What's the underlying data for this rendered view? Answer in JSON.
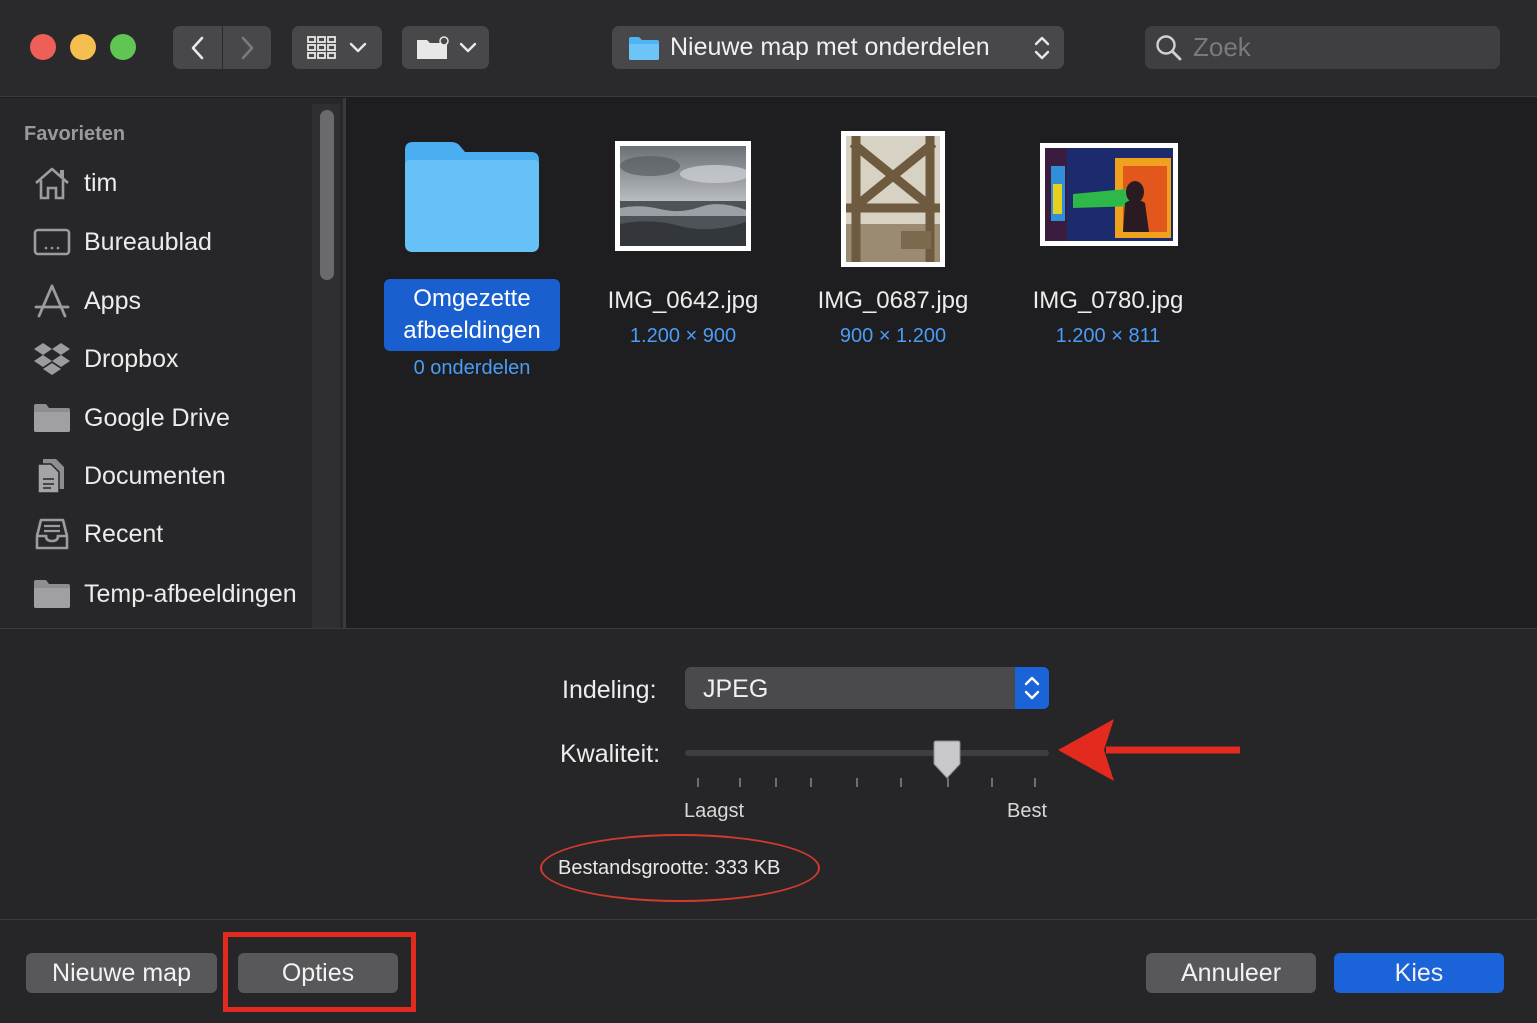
{
  "toolbar": {
    "path_label": "Nieuwe map met onderdelen",
    "search_placeholder": "Zoek",
    "icons": [
      "chevron-left-icon",
      "chevron-right-icon",
      "grid-view-icon",
      "chevron-down-icon",
      "folder-action-icon",
      "folder-icon",
      "updown-arrows-icon",
      "search-icon"
    ]
  },
  "sidebar": {
    "heading": "Favorieten",
    "items": [
      {
        "label": "tim",
        "icon": "home-icon"
      },
      {
        "label": "Bureaublad",
        "icon": "desktop-icon"
      },
      {
        "label": "Apps",
        "icon": "apps-icon"
      },
      {
        "label": "Dropbox",
        "icon": "dropbox-icon"
      },
      {
        "label": "Google Drive",
        "icon": "folder-icon"
      },
      {
        "label": "Documenten",
        "icon": "document-icon"
      },
      {
        "label": "Recent",
        "icon": "recent-icon"
      },
      {
        "label": "Temp-afbeeldingen",
        "icon": "folder-icon"
      }
    ]
  },
  "files": [
    {
      "name_line1": "Omgezette",
      "name_line2": "afbeeldingen",
      "meta": "0 onderdelen",
      "kind": "folder",
      "selected": true
    },
    {
      "name": "IMG_0642.jpg",
      "meta": "1.200 × 900",
      "kind": "image"
    },
    {
      "name": "IMG_0687.jpg",
      "meta": "900 × 1.200",
      "kind": "image"
    },
    {
      "name": "IMG_0780.jpg",
      "meta": "1.200 × 811",
      "kind": "image"
    }
  ],
  "options": {
    "format_label": "Indeling:",
    "format_value": "JPEG",
    "quality_label": "Kwaliteit:",
    "quality_min": "Laagst",
    "quality_max": "Best",
    "quality_level": 0.72,
    "filesize": "Bestandsgrootte:  333 KB"
  },
  "buttons": {
    "new_folder": "Nieuwe map",
    "options": "Opties",
    "cancel": "Annuleer",
    "choose": "Kies"
  },
  "colors": {
    "accent": "#1a63d8",
    "annotation": "#e32a1e"
  }
}
